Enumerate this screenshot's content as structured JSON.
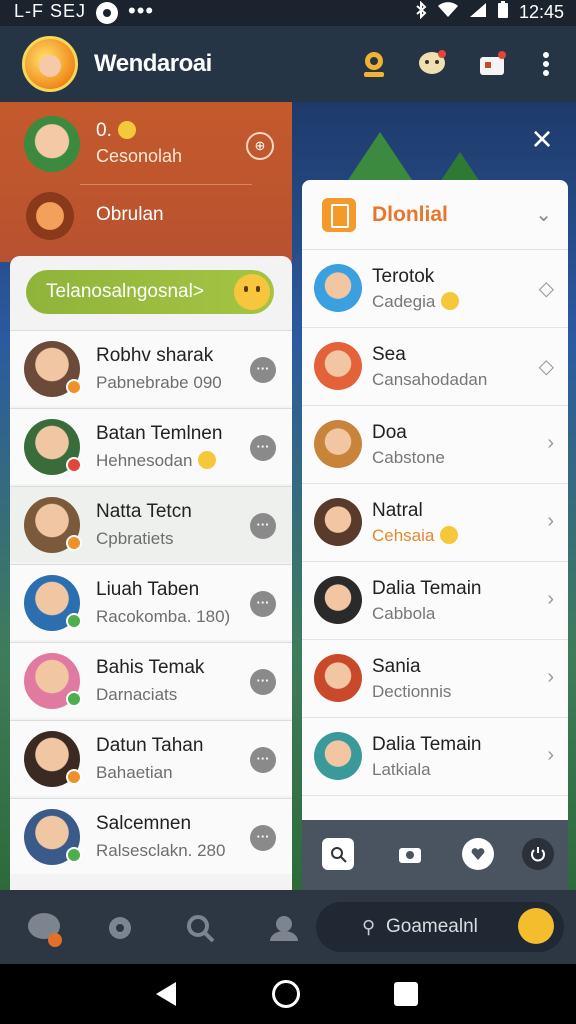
{
  "status_bar": {
    "left_text": "L-F SEJ",
    "time": "12:45"
  },
  "app_bar": {
    "title": "Wendaroai"
  },
  "close_label": "×",
  "header_panel": {
    "profile_name": "0.",
    "profile_sub": "Cesonolah",
    "profile_badge": "⊕",
    "secondary_name": "Obrulan"
  },
  "left_list": {
    "pill_label": "Telanosalngosnal>",
    "contacts": [
      {
        "name": "Robhv sharak",
        "status": "Pabnebrabe 090",
        "avatar_color": "#6b4a3a",
        "badge_color": "#f0902a"
      },
      {
        "name": "Batan Temlnen",
        "status": "Hehnesodan",
        "avatar_color": "#3a6b3a",
        "badge_color": "#e2453a"
      },
      {
        "name": "Natta Tetcn",
        "status": "Cpbratiets",
        "avatar_color": "#7a5a3a",
        "badge_color": "#f0902a"
      },
      {
        "name": "Liuah Taben",
        "status": "Racokomba. 180)",
        "avatar_color": "#2c6fb0",
        "badge_color": "#4cae4c"
      },
      {
        "name": "Bahis Temak",
        "status": "Darnaciats",
        "avatar_color": "#e07aa0",
        "badge_color": "#4cae4c"
      },
      {
        "name": "Datun Tahan",
        "status": "Bahaetian",
        "avatar_color": "#3a2a22",
        "badge_color": "#f0902a"
      },
      {
        "name": "Salcemnen",
        "status": "Ralsesclakn. 280",
        "avatar_color": "#3a5a8a",
        "badge_color": "#4cae4c"
      }
    ]
  },
  "right_panel": {
    "title": "Dlonlial",
    "contacts": [
      {
        "name": "Terotok",
        "status": "Cadegia",
        "avatar_color": "#3aa0e0",
        "action": "◇",
        "highlight": false
      },
      {
        "name": "Sea",
        "status": "Cansahodadan",
        "avatar_color": "#e3623a",
        "action": "◇",
        "highlight": false
      },
      {
        "name": "Doa",
        "status": "Cabstone",
        "avatar_color": "#c8843a",
        "action": "›",
        "highlight": false
      },
      {
        "name": "Natral",
        "status": "Cehsaia",
        "avatar_color": "#5a3a2a",
        "action": "›",
        "highlight": true
      },
      {
        "name": "Dalia Temain",
        "status": "Cabbola",
        "avatar_color": "#2a2a2a",
        "action": "›",
        "highlight": false
      },
      {
        "name": "Sania",
        "status": "Dectionnis",
        "avatar_color": "#c84a2a",
        "action": "›",
        "highlight": false
      },
      {
        "name": "Dalia Temain",
        "status": "Latkiala",
        "avatar_color": "#3a9a9a",
        "action": "›",
        "highlight": false
      }
    ]
  },
  "bottom_nav": {
    "search_label": "Goamealnl"
  },
  "icons": {
    "appbar": [
      "profile-ring-icon",
      "chat-bubble-icon",
      "gift-icon",
      "more-vert-icon"
    ],
    "bottom": [
      "group-chat-icon",
      "settings-icon",
      "search-icon",
      "contacts-icon"
    ],
    "right_bottom": [
      "add-friend-icon",
      "camera-icon",
      "heart-icon",
      "power-icon"
    ]
  }
}
